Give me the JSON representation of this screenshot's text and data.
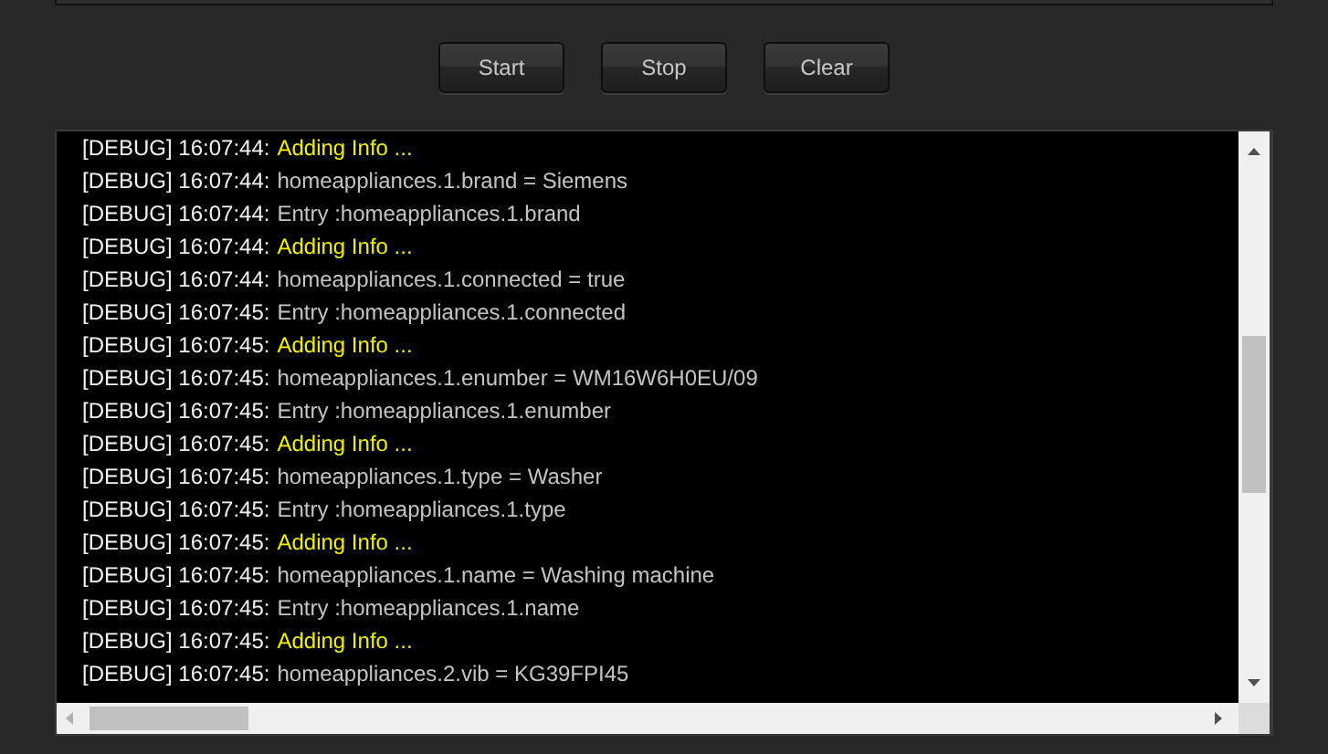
{
  "buttons": [
    {
      "label": "Start"
    },
    {
      "label": "Stop"
    },
    {
      "label": "Clear"
    }
  ],
  "log": [
    {
      "prefix": "[DEBUG] 16:07:44:",
      "message": "Adding Info ...",
      "kind": "info"
    },
    {
      "prefix": "[DEBUG] 16:07:44:",
      "message": "homeappliances.1.brand = Siemens",
      "kind": "plain"
    },
    {
      "prefix": "[DEBUG] 16:07:44:",
      "message": "Entry :homeappliances.1.brand",
      "kind": "plain"
    },
    {
      "prefix": "[DEBUG] 16:07:44:",
      "message": "Adding Info ...",
      "kind": "info"
    },
    {
      "prefix": "[DEBUG] 16:07:44:",
      "message": "homeappliances.1.connected = true",
      "kind": "plain"
    },
    {
      "prefix": "[DEBUG] 16:07:45:",
      "message": "Entry :homeappliances.1.connected",
      "kind": "plain"
    },
    {
      "prefix": "[DEBUG] 16:07:45:",
      "message": "Adding Info ...",
      "kind": "info"
    },
    {
      "prefix": "[DEBUG] 16:07:45:",
      "message": "homeappliances.1.enumber = WM16W6H0EU/09",
      "kind": "plain"
    },
    {
      "prefix": "[DEBUG] 16:07:45:",
      "message": "Entry :homeappliances.1.enumber",
      "kind": "plain"
    },
    {
      "prefix": "[DEBUG] 16:07:45:",
      "message": "Adding Info ...",
      "kind": "info"
    },
    {
      "prefix": "[DEBUG] 16:07:45:",
      "message": "homeappliances.1.type = Washer",
      "kind": "plain"
    },
    {
      "prefix": "[DEBUG] 16:07:45:",
      "message": "Entry :homeappliances.1.type",
      "kind": "plain"
    },
    {
      "prefix": "[DEBUG] 16:07:45:",
      "message": "Adding Info ...",
      "kind": "info"
    },
    {
      "prefix": "[DEBUG] 16:07:45:",
      "message": "homeappliances.1.name = Washing machine",
      "kind": "plain"
    },
    {
      "prefix": "[DEBUG] 16:07:45:",
      "message": "Entry :homeappliances.1.name",
      "kind": "plain"
    },
    {
      "prefix": "[DEBUG] 16:07:45:",
      "message": "Adding Info ...",
      "kind": "info"
    },
    {
      "prefix": "[DEBUG] 16:07:45:",
      "message": "homeappliances.2.vib = KG39FPI45",
      "kind": "plain"
    }
  ]
}
